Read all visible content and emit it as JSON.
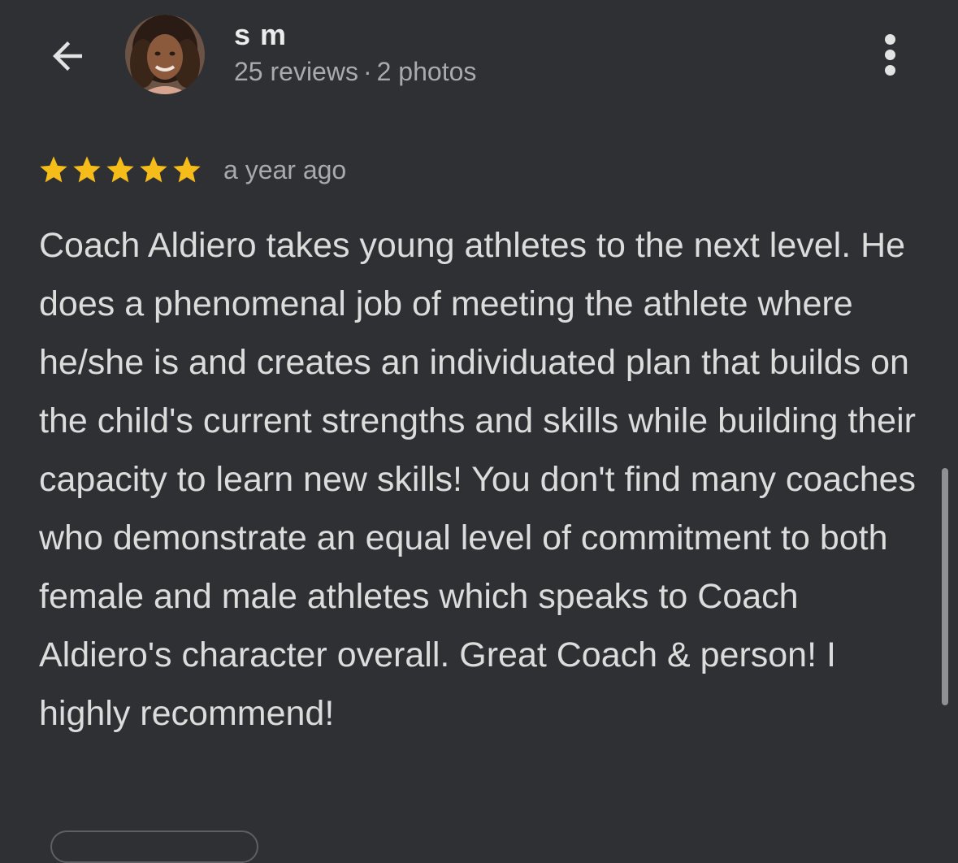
{
  "reviewer": {
    "name": "s m",
    "reviews": "25 reviews",
    "separator": "·",
    "photos": "2 photos"
  },
  "review": {
    "rating": 5,
    "max_rating": 5,
    "star_color": "#f6bd1a",
    "time": "a year ago",
    "text": "Coach Aldiero takes young athletes to the next level. He does a phenomenal job of meeting the athlete where he/she is and creates an individuated plan that builds on the child's current strengths and skills while building their capacity to learn new skills! You don't find many coaches who demonstrate an equal level of commitment to both female and male athletes which speaks to Coach Aldiero's character overall. Great Coach & person! I highly recommend!"
  },
  "icons": {
    "back": "arrow-left-icon",
    "more": "more-vertical-icon",
    "star": "star-icon"
  },
  "colors": {
    "background": "#2f3033",
    "primary_text": "#e3e3e3",
    "secondary_text": "#a9aaad"
  }
}
